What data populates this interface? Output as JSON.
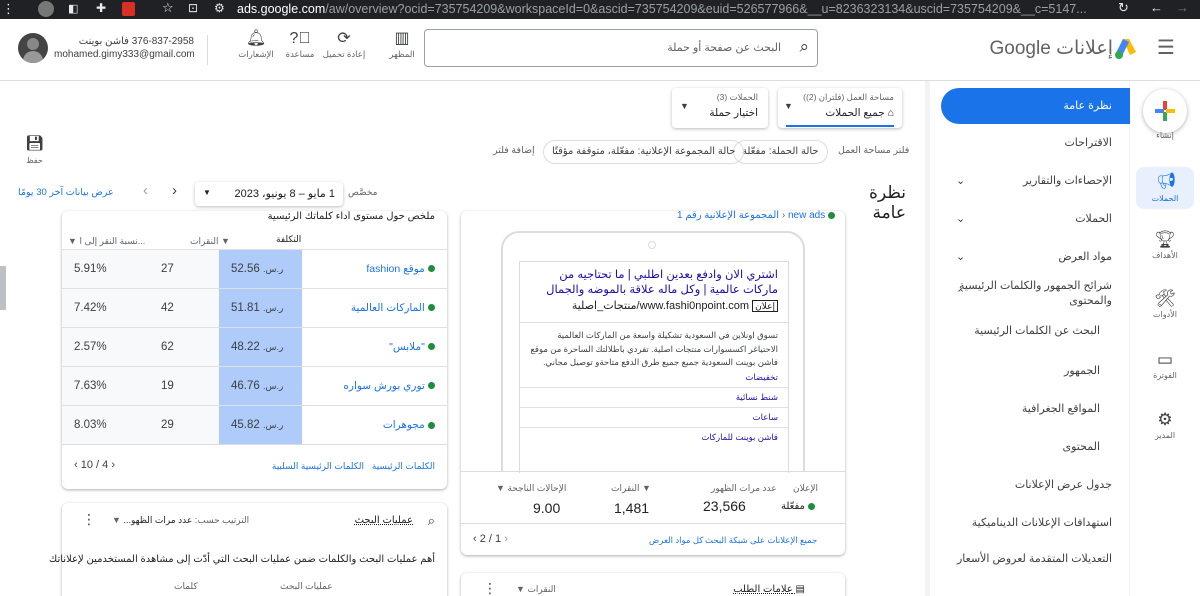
{
  "browser": {
    "url_domain": "ads.google.com",
    "url_rest": "/aw/overview?ocid=735754209&workspaceId=0&ascid=735754209&euid=526577966&__u=8236323134&uscid=735754209&__c=5147..."
  },
  "header": {
    "product": "إعلانات Google",
    "search_placeholder": "البحث عن صفحة أو حملة",
    "appearance_label": "المظهر",
    "refresh_label": "إعادة تحميل",
    "help_label": "مساعدة",
    "notifications_label": "الإشعارات",
    "account_line1": "376-837-2958 فاشن بوينت",
    "account_email": "mohamed.gimy333@gmail.com"
  },
  "rail": {
    "create": "إنشاء",
    "campaigns": "الحملات",
    "goals": "الأهداف",
    "tools": "الأدوات",
    "billing": "الفوترة",
    "admin": "المدير"
  },
  "sidenav": {
    "items": [
      {
        "label": "نظرة عامة"
      },
      {
        "label": "الاقتراحات"
      },
      {
        "label": "الإحصاءات والتقارير"
      },
      {
        "label": "الحملات"
      },
      {
        "label": "مواد العرض"
      },
      {
        "label": "شرائح الجمهور والكلمات الرئيسية والمحتوى"
      },
      {
        "label": "البحث عن الكلمات الرئيسية"
      },
      {
        "label": "الجمهور"
      },
      {
        "label": "المواقع الجغرافية"
      },
      {
        "label": "المحتوى"
      },
      {
        "label": "جدول عرض الإعلانات"
      },
      {
        "label": "استهدافات الإعلانات الديناميكية"
      },
      {
        "label": "التعديلات المتقدمة لعروض الأسعار"
      }
    ]
  },
  "toolbar": {
    "workspace_label": "مساحة العمل (فلتران (2))",
    "workspace_value": "جميع الحملات",
    "campaigns_label": "الحملات (3)",
    "campaigns_value": "اختيار حملة",
    "filter_label": "فلتر مساحة العمل",
    "filter1": "حالة الحملة: مفعّلة",
    "filter2": "حالة المجموعة الإعلانية: مفعّلة، متوقفة مؤقتًا",
    "add_filter": "إضافة فلتر",
    "save": "حفظ"
  },
  "overview": {
    "title": "نظرة عامة",
    "custom_label": "مخصَّص",
    "date_range": "1 مايو – 8 يونيو، 2023",
    "last30": "عرض بيانات آخر 30 يومًا"
  },
  "ad_card": {
    "breadcrumb_campaign": "new ads",
    "breadcrumb_group": "المجموعة الإعلانية رقم 1",
    "headline": "اشتري الان وادفع بعدين اطلبي | ما تحتاجيه من ماركات عالمية | وكل ماله علاقة بالموضه والجمال",
    "ad_badge": "إعلان",
    "display_url": "www.fashi0npoint.com/منتجات_اصلية",
    "description": "تسوق اونلاين في السعودية تشكيلة واسعة من الماركات العالمية الاحتياغر اكسسوارات منتجات اصلية. تفردي باطلالتك الساحرة من موقع فاشن بوينت السعودية جميع جميع طرق الدفع متاحةو توصيل مجاني.",
    "sitelinks": [
      "تخفيضات",
      "شنط نسائية",
      "ساعات",
      "فاشن بوينت للماركات"
    ],
    "stats_headers": [
      "الإعلان",
      "عدد مرات الظهور",
      "النقرات",
      "الإحالات الناجحة"
    ],
    "status": "مفعّلة",
    "impressions": "23,566",
    "clicks": "1,481",
    "conversions": "9.00",
    "footer_all": "جميع الإعلانات على شبكة البحث",
    "footer_assets": "كل مواد العرض",
    "pager": "2 / 1"
  },
  "kw_card": {
    "title": "ملخص حول مستوى أداء كلماتك الرئيسية",
    "col_cost": "التكلفة",
    "col_clicks": "النقرات",
    "col_ctr": "نسبة النقر إلى ا...",
    "rows": [
      {
        "keyword": "موقع fashion",
        "cost": "52.56",
        "currency": "ر.س.",
        "clicks": "27",
        "ctr": "5.91%"
      },
      {
        "keyword": "الماركات العالمية",
        "cost": "51.81",
        "currency": "ر.س.",
        "clicks": "42",
        "ctr": "7.42%"
      },
      {
        "keyword": "\"ملابس\"",
        "cost": "48.22",
        "currency": "ر.س.",
        "clicks": "62",
        "ctr": "2.57%"
      },
      {
        "keyword": "توري بورش سواره",
        "cost": "46.76",
        "currency": "ر.س.",
        "clicks": "19",
        "ctr": "7.63%"
      },
      {
        "keyword": "مجوهرات",
        "cost": "45.82",
        "currency": "ر.س.",
        "clicks": "29",
        "ctr": "8.03%"
      }
    ],
    "link_keywords": "الكلمات الرئيسية",
    "link_negative": "الكلمات الرئيسية السلبية",
    "pager": "10 / 4"
  },
  "search_card": {
    "title": "عمليات البحث",
    "sort_label": "الترتيب حسب:",
    "sort_value": "عدد مرات الظهو...",
    "description": "أهم عمليات البحث والكلمات ضمن عمليات البحث التي أدّت إلى مشاهدة المستخدمين لإعلاناتك",
    "col_search": "عمليات البحث",
    "col_words": "كلمات"
  },
  "bottom_card": {
    "title": "علامات الطلب",
    "metric": "النقرات"
  },
  "colors": {
    "accent": "#1a73e8",
    "cost_col": "#aecbfa",
    "status_green": "#1e8e3e"
  }
}
